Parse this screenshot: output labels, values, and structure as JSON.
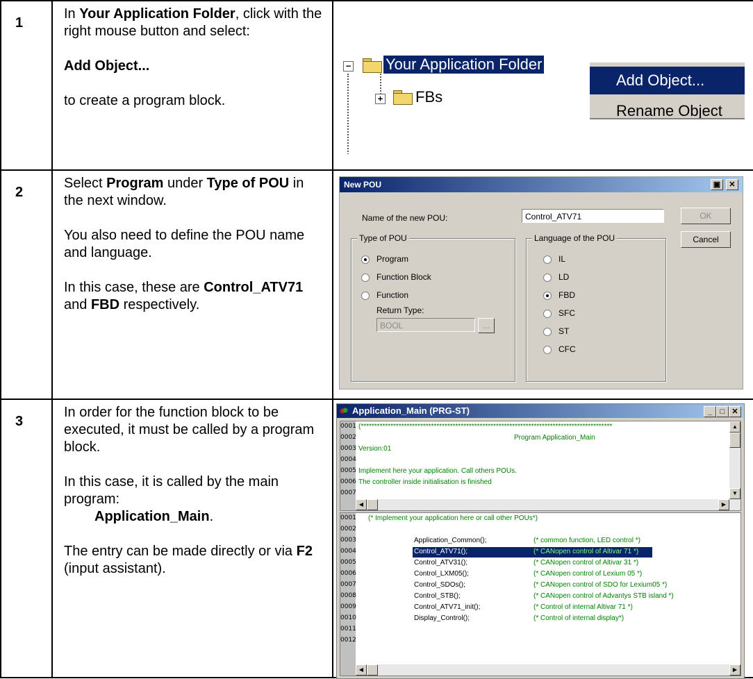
{
  "rows": [
    {
      "num": "1",
      "lines": {
        "a1": "In ",
        "a2": "Your Application Folder",
        "a3": ", click with the right mouse button and select:",
        "b": "Add Object...",
        "c": "to create a program block."
      },
      "shot": {
        "folder_label": "Your Application Folder",
        "child_label": "FBs",
        "menu": [
          "Add Object...",
          "Rename Object"
        ]
      }
    },
    {
      "num": "2",
      "lines": {
        "a1": "Select ",
        "a2": "Program",
        "a3": " under ",
        "a4": "Type of POU",
        "a5": " in the next window.",
        "b": "You also need to define the POU name and language.",
        "c1": "In this case, these are ",
        "c2": "Control_ATV71",
        "c3": " and ",
        "c4": "FBD",
        "c5": " respectively."
      },
      "shot": {
        "title": "New POU",
        "name_label": "Name of the new POU:",
        "name_value": "Control_ATV71",
        "ok": "OK",
        "cancel": "Cancel",
        "type_group": "Type of POU",
        "types": [
          "Program",
          "Function Block",
          "Function"
        ],
        "return_label": "Return Type:",
        "return_value": "BOOL",
        "browse": "...",
        "lang_group": "Language of the POU",
        "languages": [
          "IL",
          "LD",
          "FBD",
          "SFC",
          "ST",
          "CFC"
        ]
      }
    },
    {
      "num": "3",
      "lines": {
        "a": "In order for the function block to be executed, it must be called by a program block.",
        "b1": "In this case, it is  called by the main program:",
        "b2": "Application_Main",
        "b3": ".",
        "c1": "The entry can be made directly or via ",
        "c2": "F2",
        "c3": " (input assistant)."
      },
      "shot": {
        "title": "Application_Main (PRG-ST)",
        "top_lines": [
          "0001",
          "0002",
          "0003",
          "0004",
          "0005",
          "0006",
          "0007"
        ],
        "top_code": [
          "(*********************************************************************************************",
          "Program Application_Main",
          "Version:01",
          "",
          "Implement here your application. Call others POUs.",
          "The controller inside initialisation is finished",
          ""
        ],
        "bottom_lines": [
          "0001",
          "0002",
          "0003",
          "0004",
          "0005",
          "0006",
          "0007",
          "0008",
          "0009",
          "0010",
          "0011",
          "0012"
        ],
        "bottom_first": "(* Implement your application here or call other POUs*)",
        "calls": [
          {
            "call": "Application_Common();",
            "comment": "(* common function, LED control *)"
          },
          {
            "call": "Control_ATV71();",
            "comment": "(* CANopen control of Altivar 71  *)"
          },
          {
            "call": "Control_ATV31();",
            "comment": "(* CANopen control of Altivar 31 *)"
          },
          {
            "call": "Control_LXM05();",
            "comment": "(* CANopen control of Lexium 05 *)"
          },
          {
            "call": "Control_SDOs();",
            "comment": "(* CANopen control of SDO for Lexium05  *)"
          },
          {
            "call": "Control_STB();",
            "comment": "(* CANopen control of Advantys STB island  *)"
          },
          {
            "call": "Control_ATV71_init();",
            "comment": "(* Control of internal Altivar 71 *)"
          },
          {
            "call": "Display_Control();",
            "comment": "(* Control of internal display*)"
          }
        ]
      }
    }
  ]
}
